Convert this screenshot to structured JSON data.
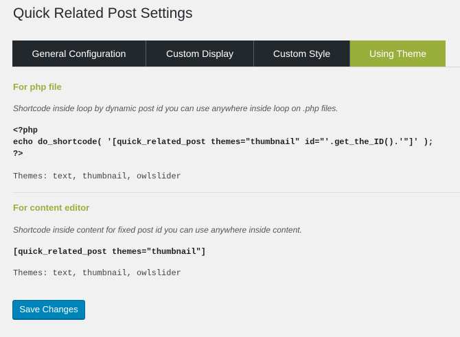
{
  "page": {
    "title": "Quick Related Post Settings"
  },
  "tabs": [
    {
      "label": "General Configuration",
      "active": false
    },
    {
      "label": "Custom Display",
      "active": false
    },
    {
      "label": "Custom Style",
      "active": false
    },
    {
      "label": "Using Theme",
      "active": true
    }
  ],
  "php_section": {
    "title": "For php file",
    "description": "Shortcode inside loop by dynamic post id you can use anywhere inside loop on .php files.",
    "code_line1": "<?php",
    "code_line2": "echo do_shortcode( '[quick_related_post themes=\"thumbnail\" id=\"'.get_the_ID().'\"]' );",
    "code_line3": "?>",
    "themes": "Themes: text, thumbnail, owlslider"
  },
  "editor_section": {
    "title": "For content editor",
    "description": "Shortcode inside content for fixed post id you can use anywhere inside content.",
    "code": "[quick_related_post themes=\"thumbnail\"]",
    "themes": "Themes: text, thumbnail, owlslider"
  },
  "actions": {
    "save_label": "Save Changes"
  },
  "colors": {
    "accent": "#9aaf3b",
    "tab_dark": "#23282d",
    "button_primary": "#0085ba"
  }
}
